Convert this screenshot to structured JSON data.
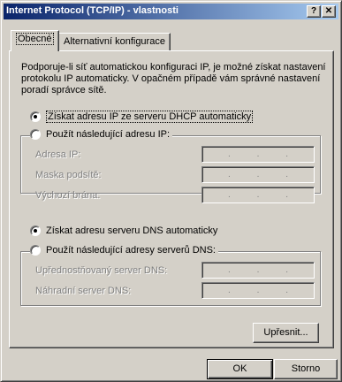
{
  "window": {
    "title": "Internet Protocol (TCP/IP) - vlastnosti",
    "help_glyph": "?",
    "close_glyph": "✕"
  },
  "tabs": [
    {
      "label": "Obecné",
      "active": true
    },
    {
      "label": "Alternativní konfigurace",
      "active": false
    }
  ],
  "description": "Podporuje-li síť automatickou konfiguraci IP, je možné získat nastavení protokolu IP automaticky. V opačném případě vám správné nastavení poradí správce sítě.",
  "ip": {
    "auto_option": {
      "label": "Získat adresu IP ze serveru DHCP automaticky",
      "selected": true
    },
    "manual_option": {
      "label": "Použít následující adresu IP:",
      "selected": false
    },
    "fields": [
      {
        "label": "Adresa IP:"
      },
      {
        "label": "Maska podsítě:"
      },
      {
        "label": "Výchozí brána:"
      }
    ]
  },
  "dns": {
    "auto_option": {
      "label": "Získat adresu serveru DNS automaticky",
      "selected": true
    },
    "manual_option": {
      "label": "Použít následující adresy serverů DNS:",
      "selected": false
    },
    "fields": [
      {
        "label": "Upřednostňovaný server DNS:"
      },
      {
        "label": "Náhradní server DNS:"
      }
    ]
  },
  "ip_dot": ".",
  "buttons": {
    "advanced": "Upřesnit...",
    "ok": "OK",
    "cancel": "Storno"
  }
}
